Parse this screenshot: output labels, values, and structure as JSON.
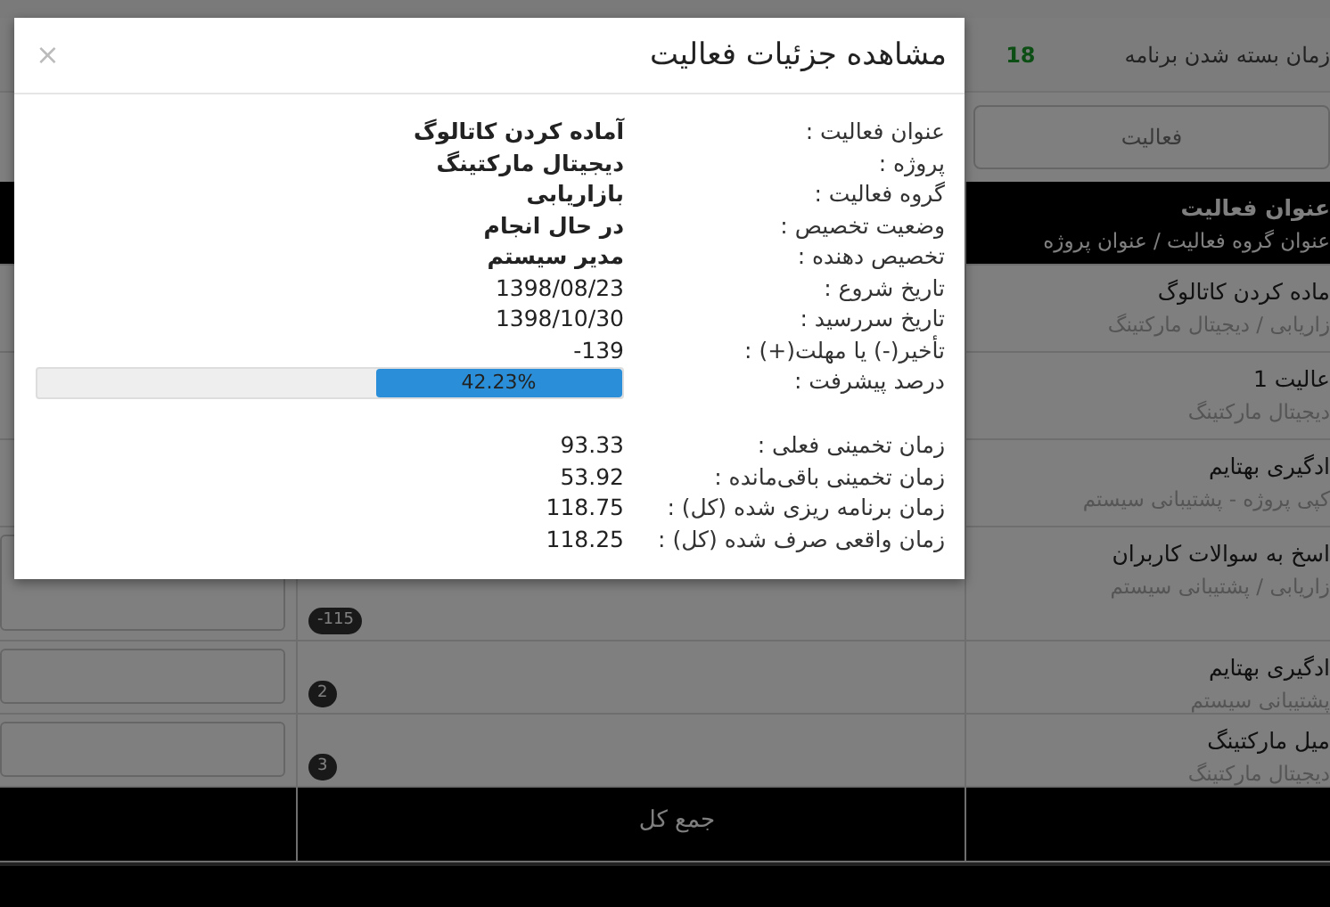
{
  "page": {
    "closing_label": "زمان بسته شدن برنامه",
    "closing_value": "18",
    "search": {
      "placeholder": "فعالیت"
    },
    "table": {
      "header_title": "عنوان فعالیت",
      "header_subtitle": "عنوان گروه فعالیت / عنوان پروژه",
      "rows": [
        {
          "title": "ماده کردن کاتالوگ",
          "subtitle": "زاریابی / دیجیتال مارکتینگ",
          "field": false
        },
        {
          "title": "عالیت 1",
          "subtitle": "دیجیتال مارکتینگ",
          "field": false
        },
        {
          "title": "ادگیری بهتایم",
          "subtitle": "کپی پروژه - پشتیبانی سیستم",
          "field": false
        },
        {
          "title": "اسخ به سوالات کاربران",
          "subtitle": "زاریابی / پشتیبانی سیستم",
          "field": true,
          "badge": "-115"
        },
        {
          "title": "ادگیری بهتایم",
          "subtitle": "پشتیبانی سیستم",
          "field": true,
          "badge": "2"
        },
        {
          "title": "میل مارکتینگ",
          "subtitle": "دیجیتال مارکتینگ",
          "field": true,
          "badge": "3"
        }
      ],
      "footer": "جمع کل"
    }
  },
  "modal": {
    "title": "مشاهده جزئیات فعالیت",
    "close": "×",
    "details": [
      {
        "kind": "text",
        "label": "عنوان فعالیت :",
        "value": "آماده کردن کاتالوگ",
        "bold": true
      },
      {
        "kind": "text",
        "label": "پروژه :",
        "value": "دیجیتال مارکتینگ",
        "bold": true
      },
      {
        "kind": "text",
        "label": "گروه فعالیت :",
        "value": "بازاریابی",
        "bold": true
      },
      {
        "kind": "text",
        "label": "وضعیت تخصیص :",
        "value": "در حال انجام",
        "bold": true
      },
      {
        "kind": "text",
        "label": "تخصیص دهنده :",
        "value": "مدیر سیستم",
        "bold": true
      },
      {
        "kind": "text",
        "label": "تاریخ شروع :",
        "value": "1398/08/23",
        "bold": false
      },
      {
        "kind": "text",
        "label": "تاریخ سررسید :",
        "value": "1398/10/30",
        "bold": false
      },
      {
        "kind": "text",
        "label": "تأخیر(-) یا مهلت(+) :",
        "value": "-139",
        "bold": false
      },
      {
        "kind": "progress",
        "label": "درصد پیشرفت :",
        "value": "42.23%",
        "level": 0.4223
      }
    ],
    "times": [
      {
        "kind": "text",
        "label": "زمان تخمینی فعلی :",
        "value": "93.33",
        "bold": false
      },
      {
        "kind": "text",
        "label": "زمان تخمینی باقی‌مانده :",
        "value": "53.92",
        "bold": false
      },
      {
        "kind": "text",
        "label": "زمان برنامه ریزی شده (کل) :",
        "value": "118.75",
        "bold": false
      },
      {
        "kind": "text",
        "label": "زمان واقعی صرف شده (کل) :",
        "value": "118.25",
        "bold": false
      }
    ]
  }
}
